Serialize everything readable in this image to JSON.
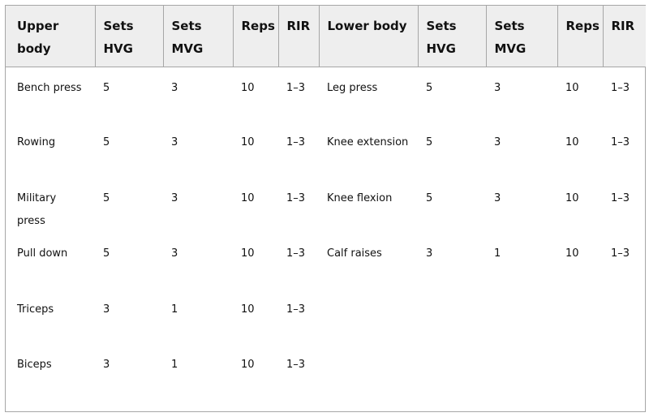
{
  "table": {
    "headers": {
      "upper_name": "Upper body",
      "upper_sets_hvg_1": "Sets",
      "upper_sets_hvg_2": "HVG",
      "upper_sets_mvg_1": "Sets",
      "upper_sets_mvg_2": "MVG",
      "upper_reps": "Reps",
      "upper_rir": "RIR",
      "lower_name": "Lower body",
      "lower_sets_hvg_1": "Sets",
      "lower_sets_hvg_2": "HVG",
      "lower_sets_mvg_1": "Sets",
      "lower_sets_mvg_2": "MVG",
      "lower_reps": "Reps",
      "lower_rir": "RIR"
    },
    "rows": [
      {
        "upper": {
          "name": "Bench press",
          "hvg": "5",
          "mvg": "3",
          "reps": "10",
          "rir": "1–3"
        },
        "lower": {
          "name": "Leg press",
          "hvg": "5",
          "mvg": "3",
          "reps": "10",
          "rir": "1–3"
        }
      },
      {
        "upper": {
          "name": "Rowing",
          "hvg": "5",
          "mvg": "3",
          "reps": "10",
          "rir": "1–3"
        },
        "lower": {
          "name": "Knee extension",
          "hvg": "5",
          "mvg": "3",
          "reps": "10",
          "rir": "1–3"
        }
      },
      {
        "upper": {
          "name": "Military press",
          "hvg": "5",
          "mvg": "3",
          "reps": "10",
          "rir": "1–3"
        },
        "lower": {
          "name": "Knee flexion",
          "hvg": "5",
          "mvg": "3",
          "reps": "10",
          "rir": "1–3"
        }
      },
      {
        "upper": {
          "name": "Pull down",
          "hvg": "5",
          "mvg": "3",
          "reps": "10",
          "rir": "1–3"
        },
        "lower": {
          "name": "Calf raises",
          "hvg": "3",
          "mvg": "1",
          "reps": "10",
          "rir": "1–3"
        }
      },
      {
        "upper": {
          "name": "Triceps",
          "hvg": "3",
          "mvg": "1",
          "reps": "10",
          "rir": "1–3"
        },
        "lower": {
          "name": "",
          "hvg": "",
          "mvg": "",
          "reps": "",
          "rir": ""
        }
      },
      {
        "upper": {
          "name": "Biceps",
          "hvg": "3",
          "mvg": "1",
          "reps": "10",
          "rir": "1–3"
        },
        "lower": {
          "name": "",
          "hvg": "",
          "mvg": "",
          "reps": "",
          "rir": ""
        }
      }
    ]
  }
}
